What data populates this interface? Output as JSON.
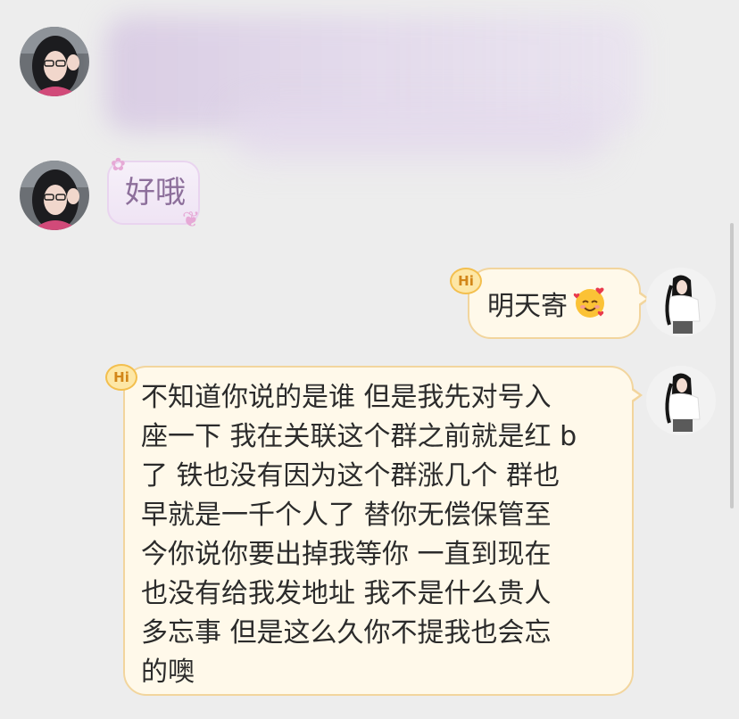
{
  "messages": [
    {
      "sender": "other",
      "text": "",
      "blurred": true
    },
    {
      "sender": "other",
      "text": "好哦"
    },
    {
      "sender": "self",
      "text": "明天寄",
      "emoji": "smiling-face-with-hearts",
      "badge": "Hi"
    },
    {
      "sender": "self",
      "badge": "Hi",
      "lines": [
        "不知道你说的是谁 但是我先对号入",
        "座一下 我在关联这个群之前就是红 b",
        "了 铁也没有因为这个群涨几个 群也",
        "早就是一千个人了 替你无偿保管至",
        "今你说你要出掉我等你 一直到现在",
        "也没有给我发地址 我不是什么贵人",
        "多忘事 但是这么久你不提我也会忘",
        "的噢"
      ]
    }
  ],
  "colors": {
    "background": "#ededed",
    "incoming_bubble": "#f3e9f6",
    "incoming_text": "#8d6f9b",
    "outgoing_bubble": "#fff9ea",
    "outgoing_border": "#f2d59d",
    "badge": "#fde7a6"
  },
  "icons": {
    "badge_icon": "hi-badge-icon",
    "emoji": "smiling-face-with-hearts-icon"
  }
}
